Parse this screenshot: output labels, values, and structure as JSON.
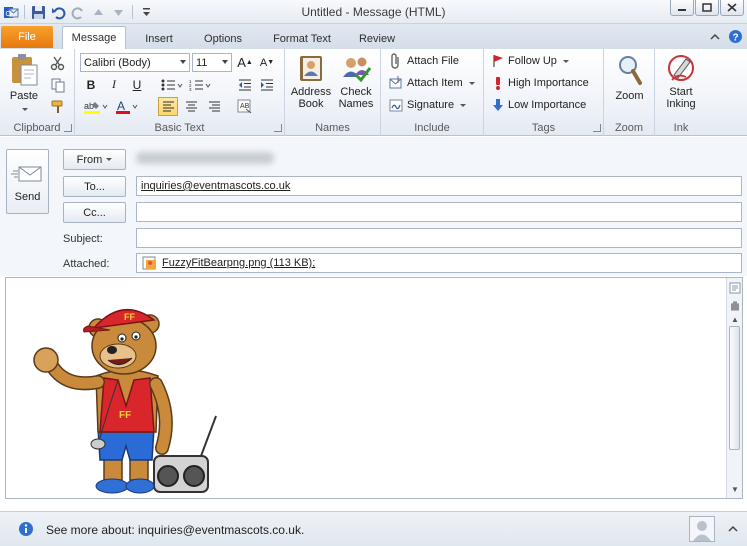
{
  "window": {
    "title": "Untitled  -  Message (HTML)"
  },
  "tabs": [
    {
      "label": "File"
    },
    {
      "label": "Message"
    },
    {
      "label": "Insert"
    },
    {
      "label": "Options"
    },
    {
      "label": "Format Text"
    },
    {
      "label": "Review"
    }
  ],
  "ribbon": {
    "clipboard": {
      "label": "Clipboard",
      "paste": "Paste"
    },
    "basic_text": {
      "label": "Basic Text",
      "font_name": "Calibri (Body)",
      "font_size": "11"
    },
    "names": {
      "label": "Names",
      "address_book_1": "Address",
      "address_book_2": "Book",
      "check_names_1": "Check",
      "check_names_2": "Names"
    },
    "include": {
      "label": "Include",
      "attach_file": "Attach File",
      "attach_item": "Attach Item",
      "signature": "Signature"
    },
    "tags": {
      "label": "Tags",
      "follow_up": "Follow Up",
      "high_importance": "High Importance",
      "low_importance": "Low Importance"
    },
    "zoom": {
      "label": "Zoom",
      "zoom_btn": "Zoom"
    },
    "ink": {
      "label": "Ink",
      "start_1": "Start",
      "start_2": "Inking"
    }
  },
  "header": {
    "send": "Send",
    "from_label": "From",
    "to_label": "To...",
    "to_value": "inquiries@eventmascots.co.uk",
    "cc_label": "Cc...",
    "subject_label": "Subject:",
    "attached_label": "Attached:",
    "attachment": "FuzzyFitBearpng.png (113 KB);"
  },
  "people_pane": {
    "text": "See more about: inquiries@eventmascots.co.uk."
  },
  "colors": {
    "file_tab": "#e6790e",
    "highlight": "#ffff00",
    "font_color": "#d9141b"
  }
}
